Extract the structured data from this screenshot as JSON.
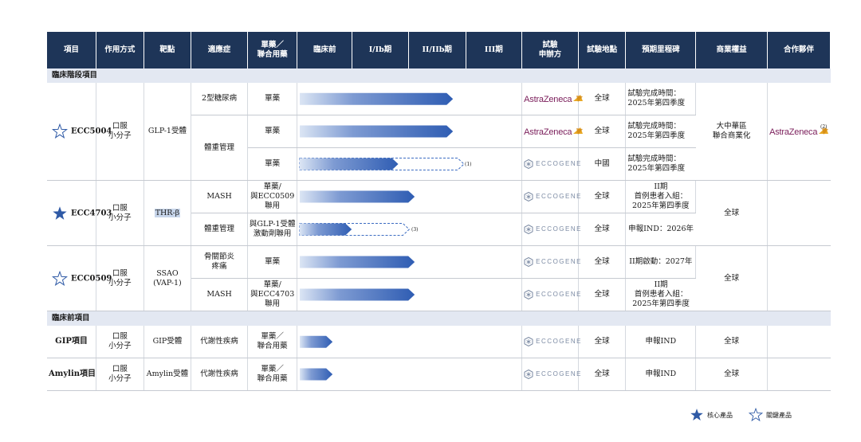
{
  "headers": {
    "project": "項目",
    "mechanism": "作用方式",
    "target": "靶點",
    "indication": "適應症",
    "therapy": "單藥／\n聯合用藥",
    "preclinical": "臨床前",
    "phase1": "I/Ib期",
    "phase2": "II/IIb期",
    "phase3": "III期",
    "sponsor": "試驗\n申辦方",
    "location": "試驗地點",
    "milestone": "預期里程碑",
    "commercial": "商業權益",
    "partner": "合作夥伴"
  },
  "sections": {
    "clinical": "臨床階段項目",
    "preclinical": "臨床前項目"
  },
  "products": {
    "ecc5004": {
      "name": "ECC5004",
      "star": "outline",
      "mechanism": "口服\n小分子",
      "target": "GLP-1受體",
      "commercial": "大中華區\n聯合商業化",
      "partner": "AstraZeneca",
      "partner_note": "(2)"
    },
    "ecc4703": {
      "name": "ECC4703",
      "star": "filled",
      "mechanism": "口服\n小分子",
      "target": "THR-β",
      "commercial": "全球"
    },
    "ecc0509": {
      "name": "ECC0509",
      "star": "outline",
      "mechanism": "口服\n小分子",
      "target": "SSAO\n(VAP-1)",
      "commercial": "全球"
    },
    "gip": {
      "name": "GIP項目",
      "mechanism": "口服\n小分子",
      "target": "GIP受體",
      "commercial": "全球"
    },
    "amylin": {
      "name": "Amylin項目",
      "mechanism": "口服\n小分子",
      "target": "Amylin受體",
      "commercial": "全球"
    }
  },
  "rows": [
    {
      "indication": "2型糖尿病",
      "therapy": "單藥",
      "sponsor": "AstraZeneca",
      "location": "全球",
      "milestone": "試驗完成時間：\n2025年第四季度"
    },
    {
      "indication": "體重管理",
      "therapy": "單藥",
      "sponsor": "AstraZeneca",
      "location": "全球",
      "milestone": "試驗完成時間：\n2025年第四季度"
    },
    {
      "therapy": "單藥",
      "sponsor": "ECCOGENE",
      "location": "中國",
      "milestone": "試驗完成時間：\n2025年第四季度",
      "note": "(1)"
    },
    {
      "indication": "MASH",
      "therapy": "單藥/\n與ECC0509\n聯用",
      "sponsor": "ECCOGENE",
      "location": "全球",
      "milestone": "II期\n首例患者入組：\n2025年第四季度"
    },
    {
      "indication": "體重管理",
      "therapy": "與GLP-1受體\n激動劑聯用",
      "sponsor": "ECCOGENE",
      "location": "全球",
      "milestone": "申報IND：2026年",
      "note": "(3)"
    },
    {
      "indication": "骨關節炎\n疼痛",
      "therapy": "單藥",
      "sponsor": "ECCOGENE",
      "location": "全球",
      "milestone": "II期啟動：2027年"
    },
    {
      "indication": "MASH",
      "therapy": "單藥/\n與ECC4703\n聯用",
      "sponsor": "ECCOGENE",
      "location": "全球",
      "milestone": "II期\n首例患者入組：\n2025年第四季度"
    },
    {
      "indication": "代謝性疾病",
      "therapy": "單藥／\n聯合用藥",
      "sponsor": "ECCOGENE",
      "location": "全球",
      "milestone": "申報IND"
    },
    {
      "indication": "代謝性疾病",
      "therapy": "單藥／\n聯合用藥",
      "sponsor": "ECCOGENE",
      "location": "全球",
      "milestone": "申報IND"
    }
  ],
  "progress": [
    {
      "solid": 2.8,
      "dashed": 0
    },
    {
      "solid": 2.8,
      "dashed": 0
    },
    {
      "solid": 1.8,
      "dashed": 3.0
    },
    {
      "solid": 2.1,
      "dashed": 0
    },
    {
      "solid": 0.95,
      "dashed": 2.0
    },
    {
      "solid": 2.1,
      "dashed": 0
    },
    {
      "solid": 2.1,
      "dashed": 0
    },
    {
      "solid": 0.6,
      "dashed": 0
    },
    {
      "solid": 0.6,
      "dashed": 0
    }
  ],
  "legend": {
    "core": "核心產品",
    "key": "關鍵產品"
  },
  "colors": {
    "header_bg": "#1e3558",
    "section_bg": "#e3e8f2",
    "star": "#2f5aa6",
    "bar": "#3c6cc2",
    "astrazeneca": "#7a1d5a",
    "eccogene": "#7b8aa3"
  }
}
